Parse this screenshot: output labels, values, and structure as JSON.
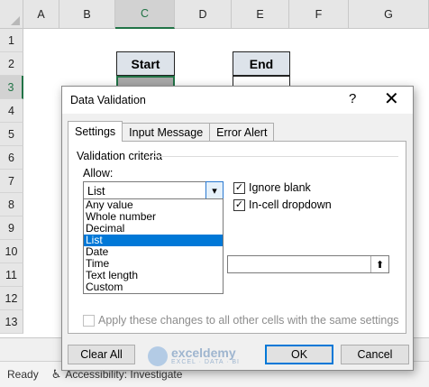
{
  "sheet": {
    "columns": [
      "A",
      "B",
      "C",
      "D",
      "E",
      "F",
      "G"
    ],
    "rows": [
      "1",
      "2",
      "3",
      "4",
      "5",
      "6",
      "7",
      "8",
      "9",
      "10",
      "11",
      "12",
      "13"
    ],
    "cells": {
      "start": "Start",
      "end": "End"
    }
  },
  "status_bar": {
    "ready": "Ready",
    "accessibility": "Accessibility: Investigate"
  },
  "dialog": {
    "title": "Data Validation",
    "help": "?",
    "close": "✕",
    "tabs": [
      "Settings",
      "Input Message",
      "Error Alert"
    ],
    "validation_criteria": "Validation criteria",
    "allow_label": "Allow:",
    "allow_value": "List",
    "allow_options": [
      "Any value",
      "Whole number",
      "Decimal",
      "List",
      "Date",
      "Time",
      "Text length",
      "Custom"
    ],
    "ignore_blank": "Ignore blank",
    "in_cell_dropdown": "In-cell dropdown",
    "apply_changes": "Apply these changes to all other cells with the same settings",
    "clear_all": "Clear All",
    "ok": "OK",
    "cancel": "Cancel"
  },
  "watermark": {
    "name": "exceldemy",
    "tagline": "EXCEL · DATA · BI"
  },
  "colors": {
    "accent": "#217346",
    "selection": "#0078d7"
  }
}
